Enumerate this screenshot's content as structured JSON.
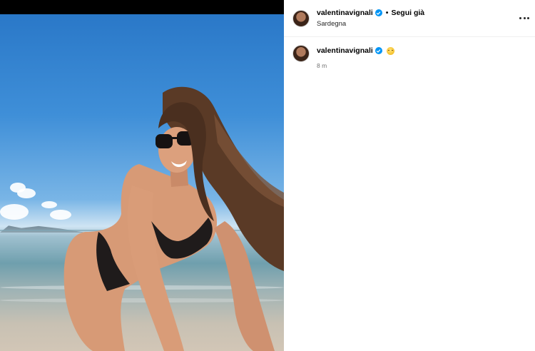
{
  "post": {
    "username": "valentinavignali",
    "verified": true,
    "separator": "•",
    "follow_label": "Segui già",
    "location": "Sardegna",
    "more_icon": "more-horizontal-icon"
  },
  "caption": {
    "username": "valentinavignali",
    "verified": true,
    "emoji": "smiling-face-icon",
    "time": "8 m"
  },
  "colors": {
    "verified_blue": "#0095f6",
    "sky": "#3f8fd8",
    "secondary_text": "#737373"
  }
}
